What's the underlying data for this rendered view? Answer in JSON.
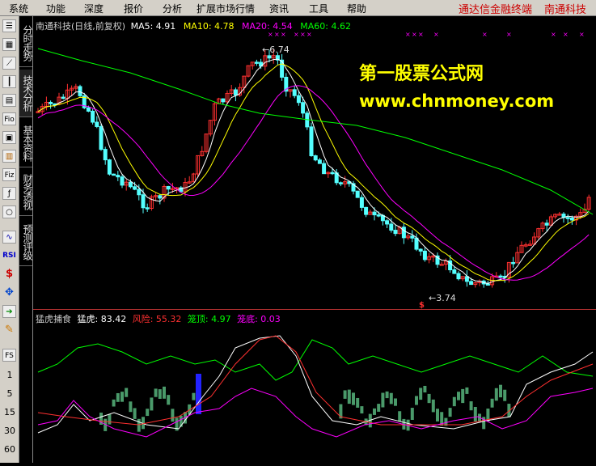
{
  "menu": {
    "items": [
      "系统",
      "功能",
      "深度",
      "报价",
      "分析",
      "扩展市场行情",
      "资讯",
      "工具",
      "帮助"
    ],
    "brand": "通达信金融终端",
    "stock": "南通科技"
  },
  "toolbar": {
    "icons": [
      "list-icon",
      "grid-icon",
      "line-chart-icon",
      "candle-icon",
      "table-icon",
      "fio-icon",
      "f10-icon",
      "doc-icon",
      "fiz-icon",
      "fx-icon",
      "search-icon",
      "wave-icon",
      "rsi-icon",
      "dollar-icon",
      "move-icon",
      "export-icon",
      "pencil-icon",
      "fs-icon"
    ],
    "rsi_label": "RSI",
    "fio_label": "Fio",
    "fiz_label": "Fiz",
    "fs_label": "FS",
    "periods": [
      "1",
      "5",
      "15",
      "30",
      "60"
    ]
  },
  "vtabs": [
    "分时走势",
    "技术分析",
    "基本资料",
    "财务透视",
    "预测评级"
  ],
  "main_header": {
    "title": "南通科技(日线,前复权)",
    "ma5": "MA5: 4.91",
    "ma10": "MA10: 4.78",
    "ma20": "MA20: 4.54",
    "ma60": "MA60: 4.62",
    "colors": {
      "ma5": "#ffffff",
      "ma10": "#ffff00",
      "ma20": "#ff00ff",
      "ma60": "#00ff00"
    }
  },
  "annotations": {
    "high": "6.74",
    "low": "3.74"
  },
  "watermark": {
    "line1": "第一股票公式网",
    "line2": "www.chnmoney.com"
  },
  "indicator_header": {
    "name": "猛虎捕食",
    "menghu": "猛虎: 83.42",
    "fengxian": "风险: 55.32",
    "longding": "笼顶: 4.97",
    "longdi": "笼底: 0.03",
    "colors": {
      "menghu": "#ffffff",
      "fengxian": "#ff3030",
      "longding": "#00ff00",
      "longdi": "#ff00ff"
    }
  },
  "colors": {
    "up": "#ff3030",
    "down": "#54ffff",
    "bar": "#4a9a6a",
    "signal": "#2222ff"
  }
}
